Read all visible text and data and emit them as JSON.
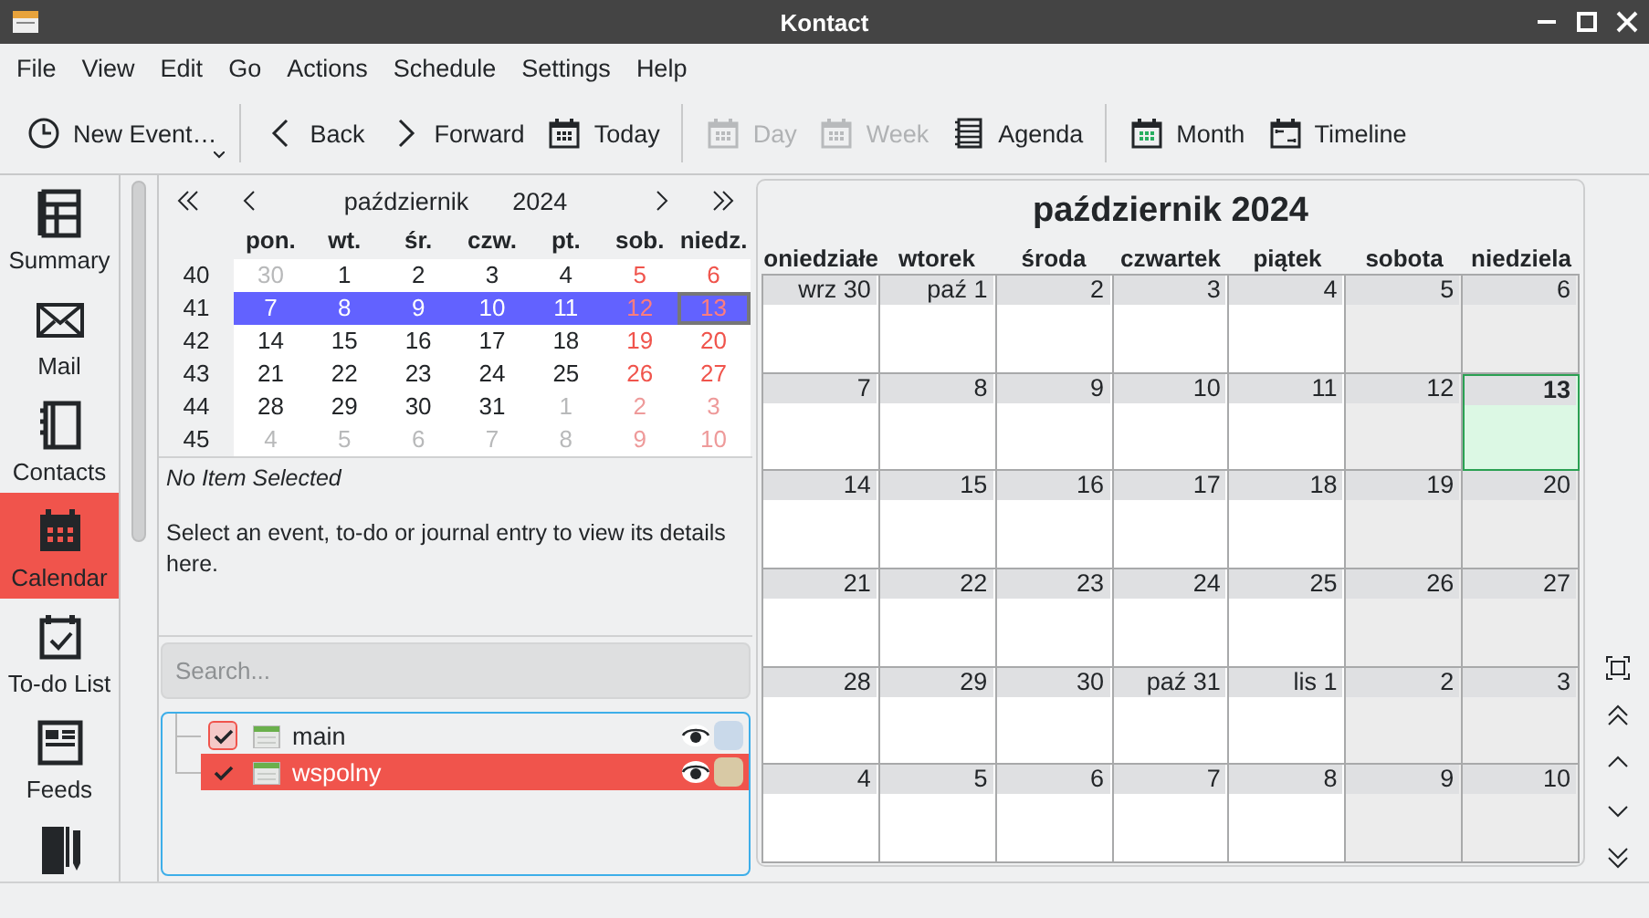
{
  "window": {
    "title": "Kontact"
  },
  "menu": [
    "File",
    "View",
    "Edit",
    "Go",
    "Actions",
    "Schedule",
    "Settings",
    "Help"
  ],
  "toolbar": [
    {
      "kind": "button",
      "label": "New Event…",
      "disabled": false,
      "dropdown": true
    },
    {
      "kind": "separator"
    },
    {
      "kind": "button",
      "label": "Back",
      "disabled": false,
      "dropdown": false
    },
    {
      "kind": "button",
      "label": "Forward",
      "disabled": false,
      "dropdown": false
    },
    {
      "kind": "button",
      "label": "Today",
      "disabled": false,
      "dropdown": false
    },
    {
      "kind": "separator"
    },
    {
      "kind": "button",
      "label": "Day",
      "disabled": true,
      "dropdown": false
    },
    {
      "kind": "button",
      "label": "Week",
      "disabled": true,
      "dropdown": false
    },
    {
      "kind": "button",
      "label": "Agenda",
      "disabled": false,
      "dropdown": false
    },
    {
      "kind": "separator"
    },
    {
      "kind": "button",
      "label": "Month",
      "disabled": false,
      "dropdown": false
    },
    {
      "kind": "button",
      "label": "Timeline",
      "disabled": false,
      "dropdown": false
    }
  ],
  "sidebar": {
    "items": [
      {
        "label": "Summary",
        "selected": false
      },
      {
        "label": "Mail",
        "selected": false
      },
      {
        "label": "Contacts",
        "selected": false
      },
      {
        "label": "Calendar",
        "selected": true
      },
      {
        "label": "To-do List",
        "selected": false
      },
      {
        "label": "Feeds",
        "selected": false
      },
      {
        "selected": false
      }
    ]
  },
  "mini_calendar": {
    "month": "październik",
    "year": "2024",
    "weekdays": [
      "pon.",
      "wt.",
      "śr.",
      "czw.",
      "pt.",
      "sob.",
      "niedz."
    ],
    "weeks": [
      {
        "number": "40",
        "selected": false,
        "days": [
          {
            "text": "30",
            "outside": true,
            "weekend": false,
            "today": false
          },
          {
            "text": "1",
            "outside": false,
            "weekend": false,
            "today": false
          },
          {
            "text": "2",
            "outside": false,
            "weekend": false,
            "today": false
          },
          {
            "text": "3",
            "outside": false,
            "weekend": false,
            "today": false
          },
          {
            "text": "4",
            "outside": false,
            "weekend": false,
            "today": false
          },
          {
            "text": "5",
            "outside": false,
            "weekend": true,
            "today": false
          },
          {
            "text": "6",
            "outside": false,
            "weekend": true,
            "today": false
          }
        ]
      },
      {
        "number": "41",
        "selected": true,
        "days": [
          {
            "text": "7",
            "outside": false,
            "weekend": false,
            "today": false
          },
          {
            "text": "8",
            "outside": false,
            "weekend": false,
            "today": false
          },
          {
            "text": "9",
            "outside": false,
            "weekend": false,
            "today": false
          },
          {
            "text": "10",
            "outside": false,
            "weekend": false,
            "today": false
          },
          {
            "text": "11",
            "outside": false,
            "weekend": false,
            "today": false
          },
          {
            "text": "12",
            "outside": false,
            "weekend": true,
            "today": false
          },
          {
            "text": "13",
            "outside": false,
            "weekend": true,
            "today": true
          }
        ]
      },
      {
        "number": "42",
        "selected": false,
        "days": [
          {
            "text": "14",
            "outside": false,
            "weekend": false,
            "today": false
          },
          {
            "text": "15",
            "outside": false,
            "weekend": false,
            "today": false
          },
          {
            "text": "16",
            "outside": false,
            "weekend": false,
            "today": false
          },
          {
            "text": "17",
            "outside": false,
            "weekend": false,
            "today": false
          },
          {
            "text": "18",
            "outside": false,
            "weekend": false,
            "today": false
          },
          {
            "text": "19",
            "outside": false,
            "weekend": true,
            "today": false
          },
          {
            "text": "20",
            "outside": false,
            "weekend": true,
            "today": false
          }
        ]
      },
      {
        "number": "43",
        "selected": false,
        "days": [
          {
            "text": "21",
            "outside": false,
            "weekend": false,
            "today": false
          },
          {
            "text": "22",
            "outside": false,
            "weekend": false,
            "today": false
          },
          {
            "text": "23",
            "outside": false,
            "weekend": false,
            "today": false
          },
          {
            "text": "24",
            "outside": false,
            "weekend": false,
            "today": false
          },
          {
            "text": "25",
            "outside": false,
            "weekend": false,
            "today": false
          },
          {
            "text": "26",
            "outside": false,
            "weekend": true,
            "today": false
          },
          {
            "text": "27",
            "outside": false,
            "weekend": true,
            "today": false
          }
        ]
      },
      {
        "number": "44",
        "selected": false,
        "days": [
          {
            "text": "28",
            "outside": false,
            "weekend": false,
            "today": false
          },
          {
            "text": "29",
            "outside": false,
            "weekend": false,
            "today": false
          },
          {
            "text": "30",
            "outside": false,
            "weekend": false,
            "today": false
          },
          {
            "text": "31",
            "outside": false,
            "weekend": false,
            "today": false
          },
          {
            "text": "1",
            "outside": true,
            "weekend": false,
            "today": false
          },
          {
            "text": "2",
            "outside": true,
            "weekend": true,
            "today": false
          },
          {
            "text": "3",
            "outside": true,
            "weekend": true,
            "today": false
          }
        ]
      },
      {
        "number": "45",
        "selected": false,
        "days": [
          {
            "text": "4",
            "outside": true,
            "weekend": false,
            "today": false
          },
          {
            "text": "5",
            "outside": true,
            "weekend": false,
            "today": false
          },
          {
            "text": "6",
            "outside": true,
            "weekend": false,
            "today": false
          },
          {
            "text": "7",
            "outside": true,
            "weekend": false,
            "today": false
          },
          {
            "text": "8",
            "outside": true,
            "weekend": false,
            "today": false
          },
          {
            "text": "9",
            "outside": true,
            "weekend": true,
            "today": false
          },
          {
            "text": "10",
            "outside": true,
            "weekend": true,
            "today": false
          }
        ]
      }
    ]
  },
  "details": {
    "title": "No Item Selected",
    "text": "Select an event, to-do or journal entry to view its details here."
  },
  "search": {
    "placeholder": "Search..."
  },
  "calendars": [
    {
      "label": "main",
      "checked": true,
      "selected": false,
      "color": "#c9d9ea"
    },
    {
      "label": "wspolny",
      "checked": true,
      "selected": true,
      "color": "#d8c9a5"
    }
  ],
  "month_view": {
    "title": "październik 2024",
    "weekdays": [
      "oniedziałe",
      "wtorek",
      "środa",
      "czwartek",
      "piątek",
      "sobota",
      "niedziela"
    ],
    "weeks": [
      [
        {
          "text": "wrz 30",
          "weekend": false,
          "today": false
        },
        {
          "text": "paź 1",
          "weekend": false,
          "today": false
        },
        {
          "text": "2",
          "weekend": false,
          "today": false
        },
        {
          "text": "3",
          "weekend": false,
          "today": false
        },
        {
          "text": "4",
          "weekend": false,
          "today": false
        },
        {
          "text": "5",
          "weekend": true,
          "today": false
        },
        {
          "text": "6",
          "weekend": true,
          "today": false
        }
      ],
      [
        {
          "text": "7",
          "weekend": false,
          "today": false
        },
        {
          "text": "8",
          "weekend": false,
          "today": false
        },
        {
          "text": "9",
          "weekend": false,
          "today": false
        },
        {
          "text": "10",
          "weekend": false,
          "today": false
        },
        {
          "text": "11",
          "weekend": false,
          "today": false
        },
        {
          "text": "12",
          "weekend": true,
          "today": false
        },
        {
          "text": "13",
          "weekend": true,
          "today": true
        }
      ],
      [
        {
          "text": "14",
          "weekend": false,
          "today": false
        },
        {
          "text": "15",
          "weekend": false,
          "today": false
        },
        {
          "text": "16",
          "weekend": false,
          "today": false
        },
        {
          "text": "17",
          "weekend": false,
          "today": false
        },
        {
          "text": "18",
          "weekend": false,
          "today": false
        },
        {
          "text": "19",
          "weekend": true,
          "today": false
        },
        {
          "text": "20",
          "weekend": true,
          "today": false
        }
      ],
      [
        {
          "text": "21",
          "weekend": false,
          "today": false
        },
        {
          "text": "22",
          "weekend": false,
          "today": false
        },
        {
          "text": "23",
          "weekend": false,
          "today": false
        },
        {
          "text": "24",
          "weekend": false,
          "today": false
        },
        {
          "text": "25",
          "weekend": false,
          "today": false
        },
        {
          "text": "26",
          "weekend": true,
          "today": false
        },
        {
          "text": "27",
          "weekend": true,
          "today": false
        }
      ],
      [
        {
          "text": "28",
          "weekend": false,
          "today": false
        },
        {
          "text": "29",
          "weekend": false,
          "today": false
        },
        {
          "text": "30",
          "weekend": false,
          "today": false
        },
        {
          "text": "paź 31",
          "weekend": false,
          "today": false
        },
        {
          "text": "lis 1",
          "weekend": false,
          "today": false
        },
        {
          "text": "2",
          "weekend": true,
          "today": false
        },
        {
          "text": "3",
          "weekend": true,
          "today": false
        }
      ],
      [
        {
          "text": "4",
          "weekend": false,
          "today": false
        },
        {
          "text": "5",
          "weekend": false,
          "today": false
        },
        {
          "text": "6",
          "weekend": false,
          "today": false
        },
        {
          "text": "7",
          "weekend": false,
          "today": false
        },
        {
          "text": "8",
          "weekend": false,
          "today": false
        },
        {
          "text": "9",
          "weekend": true,
          "today": false
        },
        {
          "text": "10",
          "weekend": true,
          "today": false
        }
      ]
    ]
  }
}
